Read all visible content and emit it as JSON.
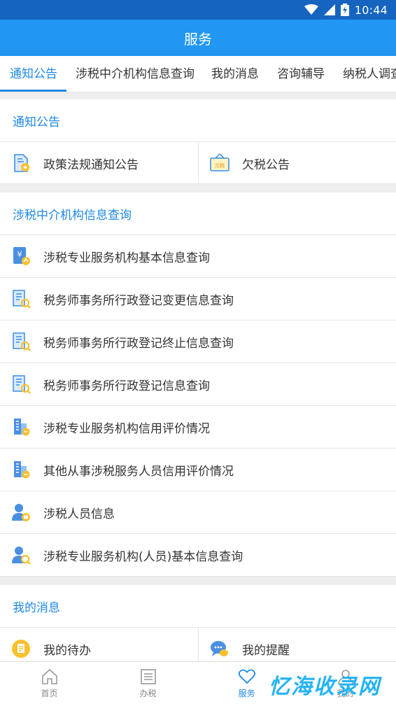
{
  "status_bar": {
    "time": "10:44"
  },
  "app_bar": {
    "title": "服务"
  },
  "tabs": [
    {
      "label": "通知公告",
      "active": true
    },
    {
      "label": "涉税中介机构信息查询"
    },
    {
      "label": "我的消息"
    },
    {
      "label": "咨询辅导"
    },
    {
      "label": "纳税人调查"
    }
  ],
  "sections": {
    "notice": {
      "title": "通知公告",
      "items": [
        {
          "label": "政策法规通知公告",
          "icon": "policy-doc-icon"
        },
        {
          "label": "欠税公告",
          "icon": "tax-arrears-icon",
          "badge": "欠税"
        }
      ]
    },
    "agency": {
      "title": "涉税中介机构信息查询",
      "items": [
        {
          "label": "涉税专业服务机构基本信息查询",
          "icon": "yuan-doc-icon",
          "glyph": "¥"
        },
        {
          "label": "税务师事务所行政登记变更信息查询",
          "icon": "office-search-icon"
        },
        {
          "label": "税务师事务所行政登记终止信息查询",
          "icon": "office-search-icon"
        },
        {
          "label": "税务师事务所行政登记信息查询",
          "icon": "office-search-icon"
        },
        {
          "label": "涉税专业服务机构信用评价情况",
          "icon": "building-rating-icon"
        },
        {
          "label": "其他从事涉税服务人员信用评价情况",
          "icon": "building-rating-icon"
        },
        {
          "label": "涉税人员信息",
          "icon": "person-badge-icon"
        },
        {
          "label": "涉税专业服务机构(人员)基本信息查询",
          "icon": "person-search-icon"
        }
      ]
    },
    "messages": {
      "title": "我的消息",
      "items": [
        {
          "label": "我的待办",
          "icon": "todo-icon"
        },
        {
          "label": "我的提醒",
          "icon": "reminder-icon"
        }
      ]
    }
  },
  "bottom_nav": [
    {
      "label": "首页",
      "icon": "home-icon"
    },
    {
      "label": "办税",
      "icon": "list-icon"
    },
    {
      "label": "服务",
      "icon": "heart-icon",
      "active": true
    },
    {
      "label": "我的",
      "icon": "user-icon"
    }
  ],
  "watermark": "忆海收录网",
  "colors": {
    "primary": "#2196f3",
    "status_bar": "#1565c0",
    "accent_text": "#1e88e5"
  }
}
